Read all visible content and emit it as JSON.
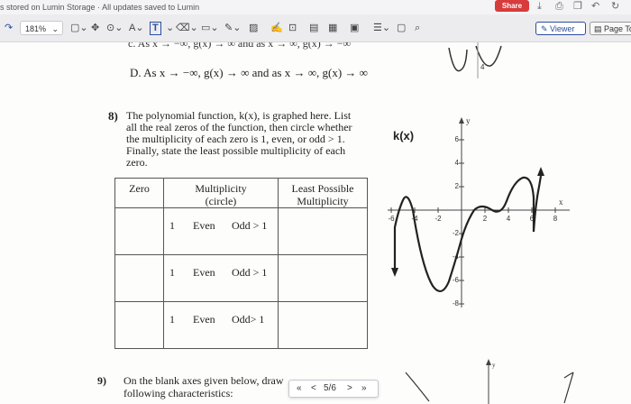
{
  "status": {
    "text": "s stored on Lumin Storage · All updates saved to Lumin",
    "share_label": "Share"
  },
  "toolbar": {
    "zoom": "181%",
    "viewer_label": "Viewer",
    "page_tools_label": "Page To"
  },
  "document": {
    "top_line": "c.  As x → −∞, g(x) → ∞ and as x → ∞, g(x) → −∞",
    "option_d": "D.  As x → −∞, g(x) → ∞ and as x → ∞, g(x) → ∞",
    "q8_number": "8)",
    "q8_lines": [
      "The polynomial function, k(x), is graphed here. List",
      "all the real zeros of the function, then circle whether",
      "the multiplicity of each zero is 1, even, or odd > 1.",
      "Finally, state the least possible multiplicity of each",
      "zero."
    ],
    "table": {
      "headers": [
        "Zero",
        "Multiplicity\n(circle)",
        "Least Possible\nMultiplicity"
      ],
      "rows": [
        {
          "c1": "1",
          "c2": "Even",
          "c3": "Odd > 1"
        },
        {
          "c1": "1",
          "c2": "Even",
          "c3": "Odd > 1"
        },
        {
          "c1": "1",
          "c2": "Even",
          "c3": "Odd> 1"
        }
      ]
    },
    "graph": {
      "label": "k(x)",
      "y_axis_label": "y",
      "x_axis_label": "x",
      "x_ticks": [
        "-6",
        "-4",
        "-2",
        "2",
        "4",
        "6",
        "8"
      ],
      "y_ticks": [
        "6",
        "4",
        "2",
        "-2",
        "-4",
        "-6",
        "-8"
      ]
    },
    "q9_number": "9)",
    "q9_lines": [
      "On the blank axes given below, draw",
      "following characteristics:"
    ]
  },
  "pager": {
    "first": "«",
    "prev": "<",
    "page": "5/6",
    "next": ">",
    "last": "»"
  }
}
